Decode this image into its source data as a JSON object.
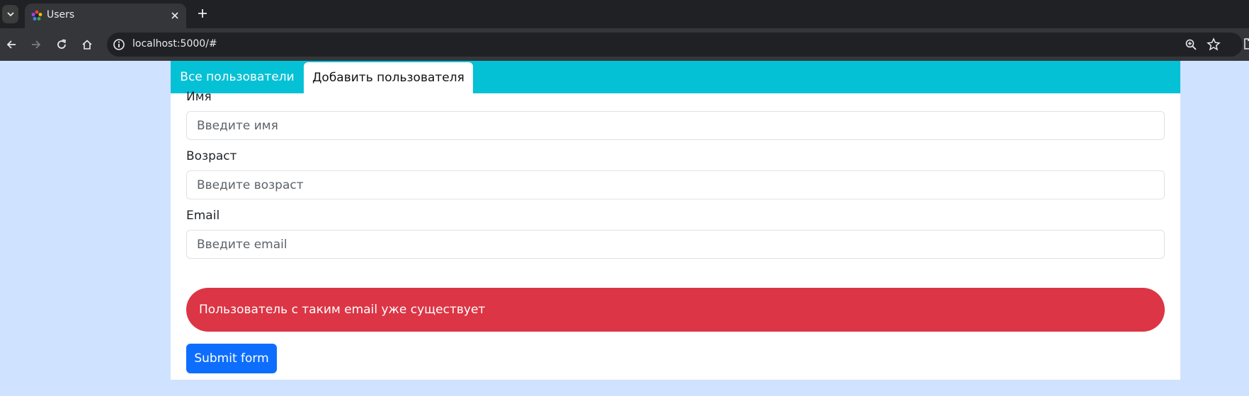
{
  "browser": {
    "tab_title": "Users",
    "url": "localhost:5000/#",
    "colors": {
      "frame": "#202124",
      "toolbar": "#35363a",
      "omnibox": "#202124"
    },
    "icons": [
      "tab-list-icon",
      "favicon-icon",
      "close-icon",
      "plus-icon",
      "back-icon",
      "forward-icon",
      "reload-icon",
      "home-icon",
      "info-icon",
      "zoom-icon",
      "star-icon",
      "extensions-icon"
    ]
  },
  "page": {
    "background": "#cfe2ff",
    "nav": {
      "color": "#05c1d6",
      "tabs": [
        {
          "label": "Все пользователи",
          "active": false
        },
        {
          "label": "Добавить пользователя",
          "active": true
        }
      ]
    },
    "form": {
      "name": {
        "label": "Имя",
        "placeholder": "Введите имя",
        "value": ""
      },
      "age": {
        "label": "Возраст",
        "placeholder": "Введите возраст",
        "value": ""
      },
      "email": {
        "label": "Email",
        "placeholder": "Введите email",
        "value": ""
      },
      "error": {
        "text": "Пользователь с таким email уже существует",
        "color": "#dc3545"
      },
      "submit_label": "Submit form",
      "submit_color": "#0d6efd"
    }
  }
}
